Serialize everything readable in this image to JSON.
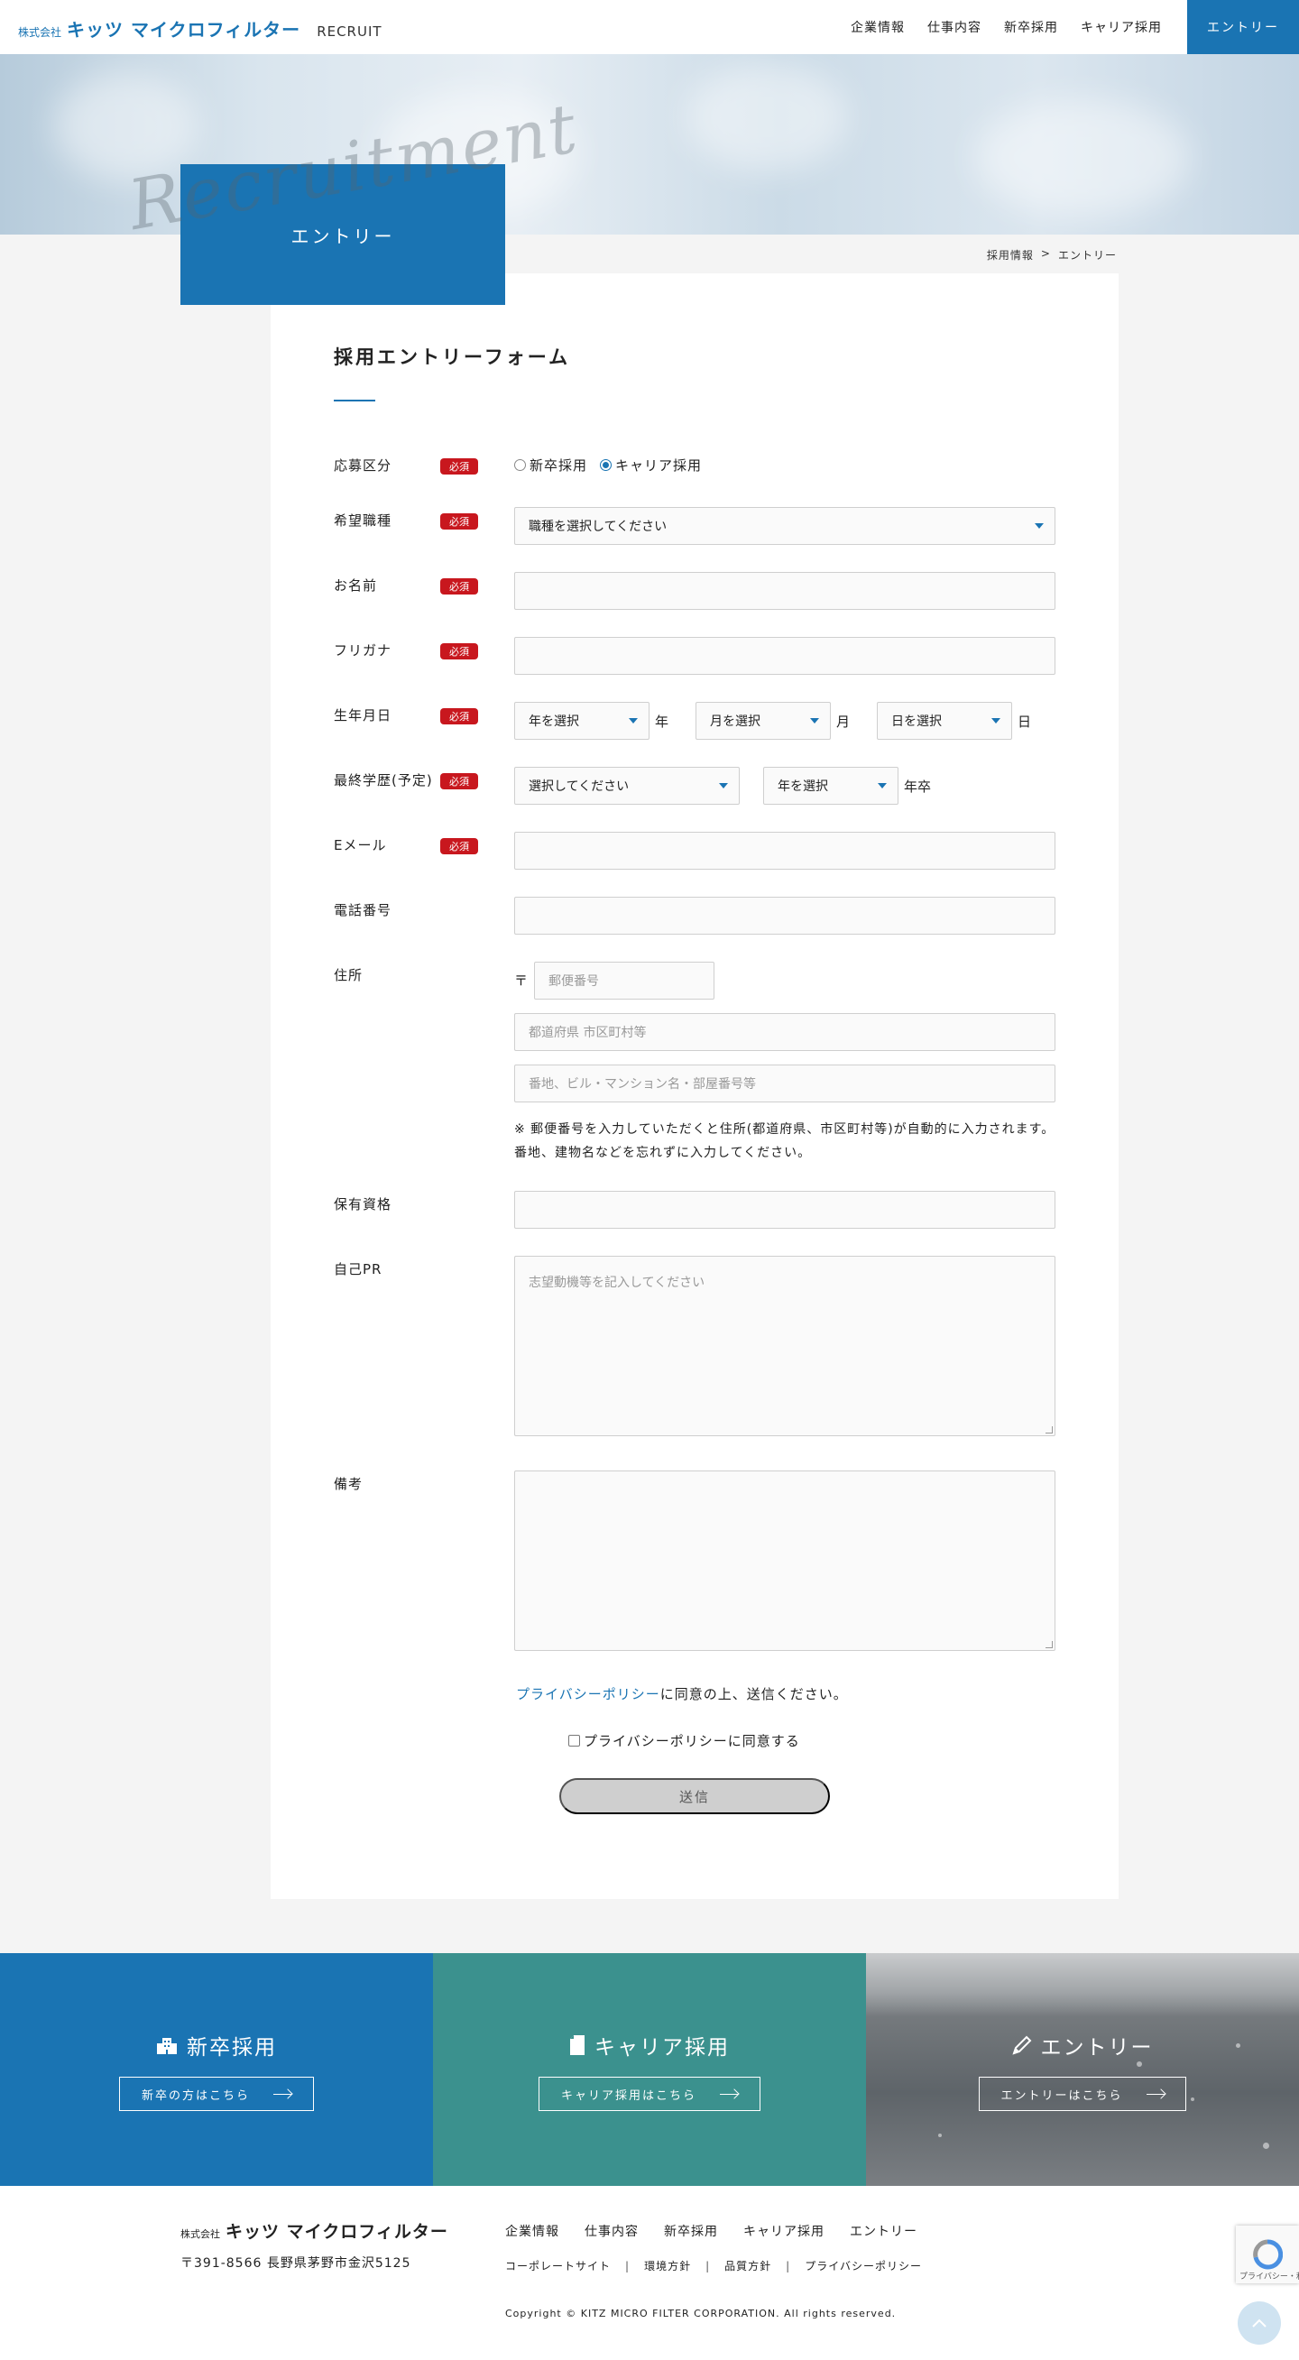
{
  "header": {
    "corp": "株式会社",
    "brand": "キッツ マイクロフィルター",
    "recruit": "RECRUIT",
    "nav": [
      "企業情報",
      "仕事内容",
      "新卒採用",
      "キャリア採用"
    ],
    "entry": "エントリー"
  },
  "hero": {
    "script": "Recruitment",
    "title": "エントリー"
  },
  "breadcrumb": {
    "items": [
      "採用情報",
      "エントリー"
    ],
    "separator": ">"
  },
  "form": {
    "title": "採用エントリーフォーム",
    "required_badge": "必須",
    "rows": {
      "category": {
        "label": "応募区分",
        "options": [
          "新卒採用",
          "キャリア採用"
        ],
        "selected": "キャリア採用"
      },
      "job": {
        "label": "希望職種",
        "value": "職種を選択してください"
      },
      "name": {
        "label": "お名前",
        "value": ""
      },
      "furigana": {
        "label": "フリガナ",
        "value": ""
      },
      "birth": {
        "label": "生年月日",
        "year": "年を選択",
        "year_unit": "年",
        "month": "月を選択",
        "month_unit": "月",
        "day": "日を選択",
        "day_unit": "日"
      },
      "education": {
        "label": "最終学歴(予定)",
        "school": "選択してください",
        "year": "年を選択",
        "unit": "年卒"
      },
      "email": {
        "label": "Eメール",
        "value": ""
      },
      "phone": {
        "label": "電話番号",
        "value": ""
      },
      "address": {
        "label": "住所",
        "postal_mark": "〒",
        "postal_placeholder": "郵便番号",
        "city_placeholder": "都道府県 市区町村等",
        "street_placeholder": "番地、ビル・マンション名・部屋番号等",
        "note": "※ 郵便番号を入力していただくと住所(都道府県、市区町村等)が自動的に入力されます。番地、建物名などを忘れずに入力してください。"
      },
      "qualification": {
        "label": "保有資格",
        "value": ""
      },
      "pr": {
        "label": "自己PR",
        "placeholder": "志望動機等を記入してください"
      },
      "remarks": {
        "label": "備考",
        "value": ""
      }
    },
    "privacy_link": "プライバシーポリシー",
    "privacy_suffix": "に同意の上、送信ください。",
    "agree_label": "プライバシーポリシーに同意する",
    "agree_checked": false,
    "submit": "送信"
  },
  "banners": [
    {
      "title": "新卒採用",
      "button": "新卒の方はこちら",
      "icon": "building-icon",
      "color": "#1a74b3"
    },
    {
      "title": "キャリア採用",
      "button": "キャリア採用はこちら",
      "icon": "document-icon",
      "color": "#3b918e"
    },
    {
      "title": "エントリー",
      "button": "エントリーはこちら",
      "icon": "pencil-icon"
    }
  ],
  "footer": {
    "corp": "株式会社",
    "brand": "キッツ マイクロフィルター",
    "address": "〒391-8566 長野県茅野市金沢5125",
    "nav": [
      "企業情報",
      "仕事内容",
      "新卒採用",
      "キャリア採用",
      "エントリー"
    ],
    "sub": [
      "コーポレートサイト",
      "環境方針",
      "品質方針",
      "プライバシーポリシー"
    ],
    "copyright": "Copyright © KITZ MICRO FILTER CORPORATION. All rights reserved.",
    "recaptcha": "プライバシー・利用規約"
  },
  "colors": {
    "primary": "#1a74b3",
    "required": "#c8171e",
    "teal": "#3b918e"
  }
}
